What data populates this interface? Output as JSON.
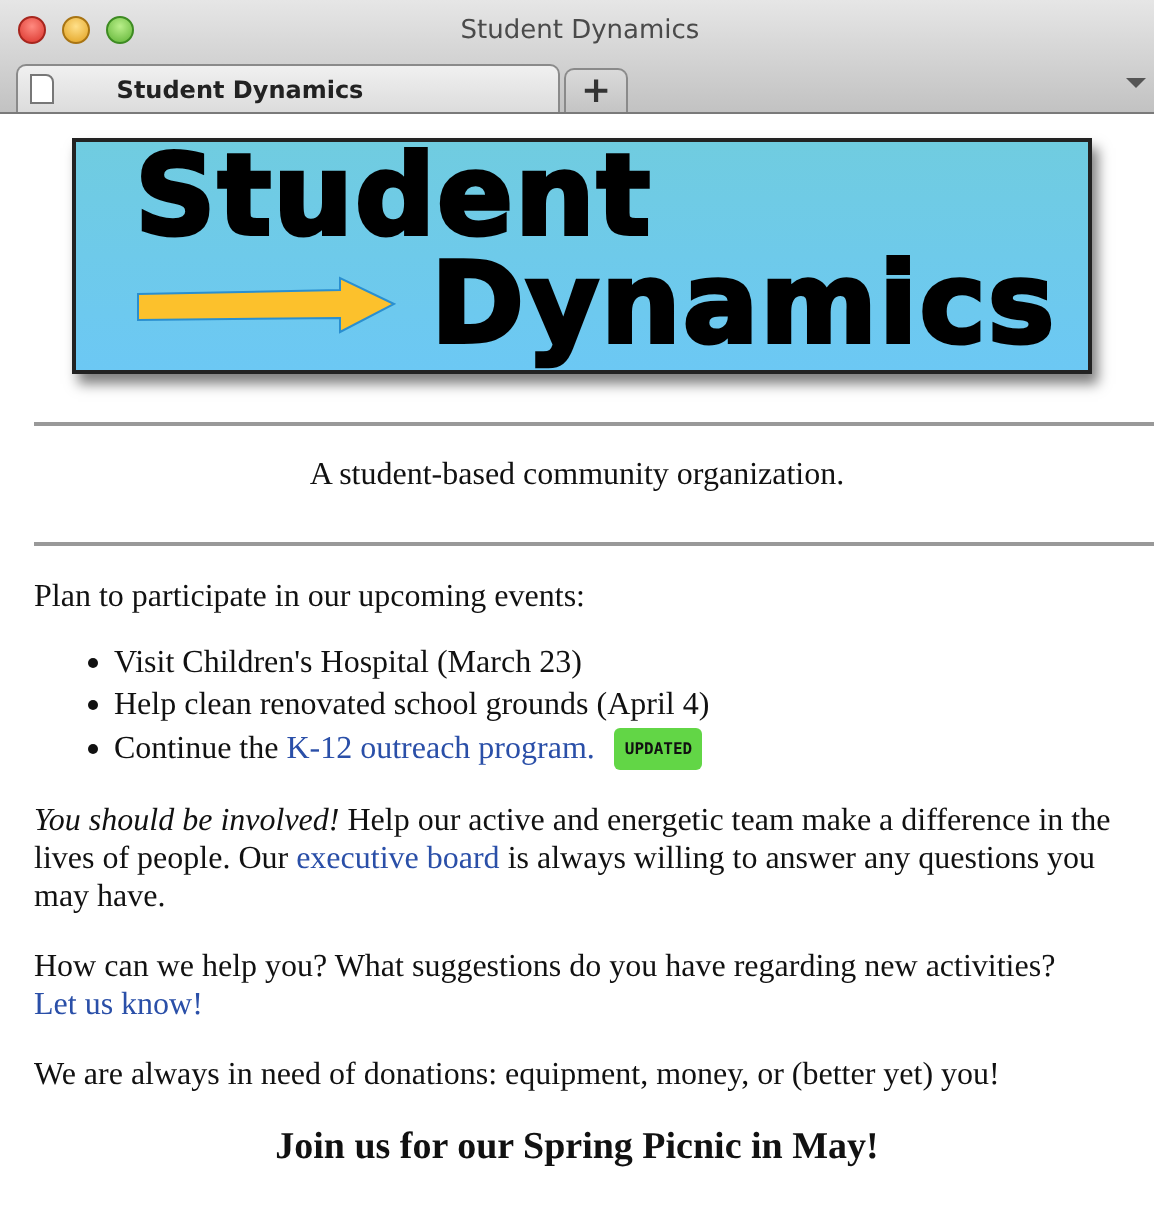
{
  "window": {
    "title": "Student Dynamics"
  },
  "tabs": [
    {
      "label": "Student Dynamics",
      "selected": true
    },
    {
      "label": "+",
      "selected": false,
      "kind": "new"
    }
  ],
  "banner": {
    "line_1": "Student",
    "line_2": "Dynamics"
  },
  "tagline": "A student-based community organization.",
  "intro": "Plan to participate in our upcoming events:",
  "events": [
    {
      "text": "Visit Children's Hospital (March 23)"
    },
    {
      "text": "Help clean renovated school grounds (April 4)"
    },
    {
      "text": "Continue the ",
      "link": "K-12 outreach program.",
      "badge": "UPDATED"
    }
  ],
  "paragraphs": [
    [
      {
        "text": "*You should be involved!* Help our active and energetic team make a difference in the lives of people. Our "
      },
      {
        "link": "executive board"
      },
      {
        "text": " is always willing to answer any questions you may have."
      }
    ],
    [
      {
        "text": "How can we help you? What suggestions do you have regarding new activities? "
      },
      {
        "link": "Let us know!"
      }
    ],
    [
      {
        "text": "We are always in need of donations: equipment, money, or (better yet) you!"
      }
    ]
  ],
  "heading": "Join us for our Spring Picnic in May!"
}
